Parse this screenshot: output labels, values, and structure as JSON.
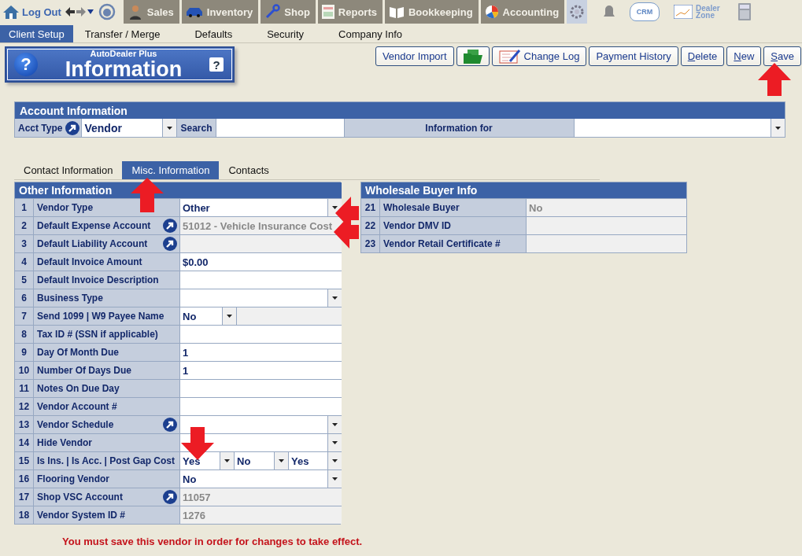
{
  "top_nav": {
    "logout": "Log Out",
    "modules": [
      {
        "label": "Sales",
        "kind": "sales"
      },
      {
        "label": "Inventory",
        "kind": "inventory"
      },
      {
        "label": "Shop",
        "kind": "shop"
      },
      {
        "label": "Reports",
        "kind": "reports"
      },
      {
        "label": "Bookkeeping",
        "kind": "book"
      },
      {
        "label": "Accounting",
        "kind": "accounting"
      }
    ],
    "crm": "CRM",
    "dealer_zone": "Dealer Zone"
  },
  "sub_nav": [
    {
      "label": "Client Setup",
      "selected": true
    },
    {
      "label": "Transfer / Merge",
      "selected": false
    },
    {
      "label": "Defaults",
      "selected": false
    },
    {
      "label": "Security",
      "selected": false
    },
    {
      "label": "Company Info",
      "selected": false
    }
  ],
  "banner": {
    "subtitle": "AutoDealer Plus",
    "title": "Information",
    "left_glyph": "?",
    "right_glyph": "?"
  },
  "toolbar": [
    {
      "kind": "text",
      "label": "Vendor Import",
      "underline_first": false
    },
    {
      "kind": "folder"
    },
    {
      "kind": "log",
      "label": "Change Log"
    },
    {
      "kind": "text",
      "label": "Payment History",
      "underline_first": false
    },
    {
      "kind": "text",
      "label": "Delete",
      "underline_first": true
    },
    {
      "kind": "text",
      "label": "New",
      "underline_first": true
    },
    {
      "kind": "text",
      "label": "Save",
      "underline_first": true
    }
  ],
  "account": {
    "title": "Account Information",
    "acct_type_label": "Acct Type",
    "acct_type_value": "Vendor",
    "search_label": "Search",
    "info_for_label": "Information for"
  },
  "tabs": [
    {
      "label": "Contact Information",
      "selected": false
    },
    {
      "label": "Misc. Information",
      "selected": true
    },
    {
      "label": "Contacts",
      "selected": false
    }
  ],
  "other": {
    "title": "Other Information",
    "rows": [
      {
        "num": "1",
        "label": "Vendor Type",
        "kind": "select",
        "link": false,
        "value": "Other"
      },
      {
        "num": "2",
        "label": "Default Expense Account",
        "kind": "readonly",
        "link": true,
        "value": "51012 - Vehicle Insurance Cost"
      },
      {
        "num": "3",
        "label": "Default Liability Account",
        "kind": "readonly",
        "link": true
      },
      {
        "num": "4",
        "label": "Default Invoice Amount",
        "kind": "text",
        "link": false,
        "value": "$0.00"
      },
      {
        "num": "5",
        "label": "Default Invoice Description",
        "kind": "text",
        "link": false
      },
      {
        "num": "6",
        "label": "Business Type",
        "kind": "select",
        "link": false
      },
      {
        "num": "7",
        "label": "Send 1099 | W9 Payee Name",
        "kind": "select_readonly",
        "link": false,
        "value": "No"
      },
      {
        "num": "8",
        "label": "Tax ID # (SSN if applicable)",
        "kind": "text",
        "link": false
      },
      {
        "num": "9",
        "label": "Day Of Month Due",
        "kind": "text",
        "link": false,
        "value": "1"
      },
      {
        "num": "10",
        "label": "Number Of Days Due",
        "kind": "text",
        "link": false,
        "value": "1"
      },
      {
        "num": "11",
        "label": "Notes On Due Day",
        "kind": "text",
        "link": false
      },
      {
        "num": "12",
        "label": "Vendor Account #",
        "kind": "text",
        "link": false
      },
      {
        "num": "13",
        "label": "Vendor Schedule",
        "kind": "select",
        "link": true
      },
      {
        "num": "14",
        "label": "Hide Vendor",
        "kind": "select",
        "link": false
      },
      {
        "num": "15",
        "label": "Is Ins. | Is Acc. | Post Gap Cost",
        "kind": "triple_select",
        "link": false,
        "values": [
          "Yes",
          "No",
          "Yes"
        ]
      },
      {
        "num": "16",
        "label": "Flooring Vendor",
        "kind": "select",
        "link": false,
        "value": "No"
      },
      {
        "num": "17",
        "label": "Shop VSC Account",
        "kind": "readonly",
        "link": true,
        "value": "11057"
      },
      {
        "num": "18",
        "label": "Vendor System ID #",
        "kind": "readonly",
        "link": false,
        "value": "1276"
      }
    ]
  },
  "wholesale": {
    "title": "Wholesale Buyer Info",
    "rows": [
      {
        "num": "21",
        "label": "Wholesale Buyer",
        "value": "No"
      },
      {
        "num": "22",
        "label": "Vendor DMV ID"
      },
      {
        "num": "23",
        "label": "Vendor Retail Certificate #"
      }
    ]
  },
  "message": "You must save this vendor in order for changes to take effect."
}
